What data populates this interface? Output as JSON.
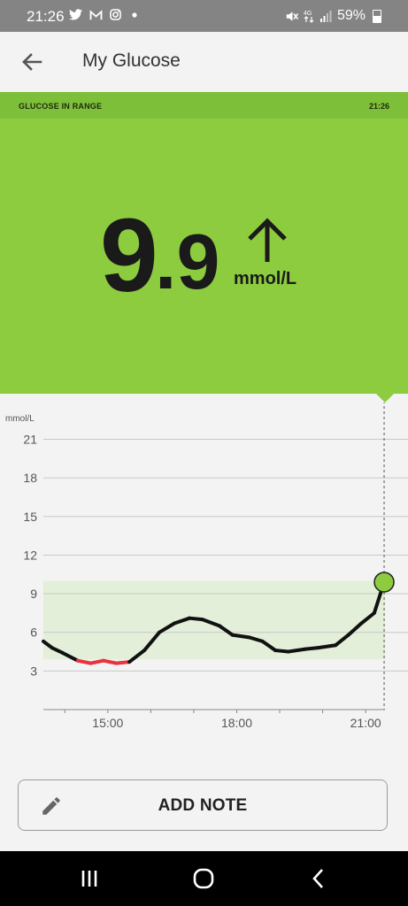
{
  "status_bar": {
    "time": "21:26",
    "battery": "59%",
    "left_icons": [
      "twitter-icon",
      "gmail-icon",
      "instagram-icon",
      "dot-icon"
    ],
    "right_icons": [
      "mute-icon",
      "4g-icon",
      "signal-icon",
      "battery-icon"
    ]
  },
  "app_bar": {
    "title": "My Glucose"
  },
  "status_header": {
    "label": "GLUCOSE IN RANGE",
    "time": "21:26"
  },
  "reading": {
    "integer": "9",
    "decimal": ".9",
    "unit": "mmol/L",
    "trend": "arrow-up-icon"
  },
  "colors": {
    "in_range_green": "#8dcb3f",
    "header_green": "#7ebf3a",
    "low_red": "#e8343c",
    "target_band": "#e3efd8"
  },
  "chart_data": {
    "type": "line",
    "ylabel": "mmol/L",
    "yticks": [
      21,
      18,
      15,
      12,
      9,
      6,
      3
    ],
    "ylim": [
      0,
      21
    ],
    "xticks": [
      "15:00",
      "18:00",
      "21:00"
    ],
    "x_unit": "hour",
    "xlim": [
      13.5,
      21.45
    ],
    "target_range": [
      3.9,
      10.0
    ],
    "low_threshold": 3.9,
    "series": [
      {
        "x": [
          13.5,
          13.7,
          13.95,
          14.3,
          14.6,
          14.9,
          15.2,
          15.5,
          15.85,
          16.2,
          16.55,
          16.9,
          17.2,
          17.6,
          17.9,
          18.3,
          18.6,
          18.9,
          19.2,
          19.6,
          19.9,
          20.3,
          20.6,
          20.9,
          21.2,
          21.43
        ],
        "y": [
          5.3,
          4.8,
          4.4,
          3.8,
          3.6,
          3.8,
          3.6,
          3.7,
          4.6,
          6.0,
          6.7,
          7.1,
          7.0,
          6.5,
          5.8,
          5.6,
          5.3,
          4.6,
          4.5,
          4.7,
          4.8,
          5.0,
          5.8,
          6.7,
          7.5,
          9.9
        ]
      }
    ],
    "current": {
      "time": "21:26",
      "value": 9.9
    }
  },
  "add_note": {
    "label": "ADD NOTE",
    "icon": "pencil-icon"
  },
  "nav_bar": {
    "items": [
      "recent-apps-icon",
      "home-icon",
      "back-nav-icon"
    ]
  }
}
